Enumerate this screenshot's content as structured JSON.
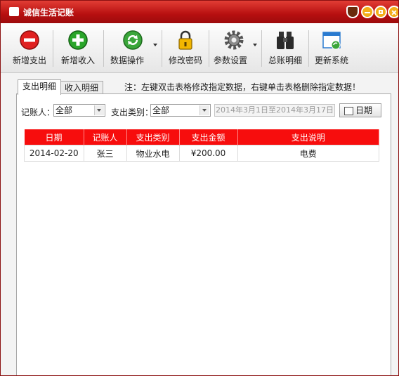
{
  "window": {
    "title": "诚信生活记账"
  },
  "toolbar": {
    "items": [
      {
        "label": "新增支出",
        "icon": "minus-circle-icon",
        "color": "#e02020"
      },
      {
        "label": "新增收入",
        "icon": "plus-circle-icon",
        "color": "#2aa52a"
      },
      {
        "label": "数据操作",
        "icon": "refresh-icon",
        "color": "#3aa63a"
      },
      {
        "label": "修改密码",
        "icon": "lock-icon",
        "color": "#f2b600"
      },
      {
        "label": "参数设置",
        "icon": "gear-icon",
        "color": "#555555"
      },
      {
        "label": "总账明细",
        "icon": "binoculars-icon",
        "color": "#333333"
      },
      {
        "label": "更新系统",
        "icon": "update-window-icon",
        "color": "#2a7bd0"
      }
    ]
  },
  "tabs": [
    {
      "label": "支出明细"
    },
    {
      "label": "收入明细"
    }
  ],
  "note": "注：左键双击表格修改指定数据，右键单击表格删除指定数据！",
  "filters": {
    "recorder_label": "记账人：",
    "recorder_value": "全部",
    "category_label": "支出类别：",
    "category_value": "全部",
    "date_range": "2014年3月1日至2014年3月17日",
    "date_button": "日期"
  },
  "table": {
    "columns": [
      "日期",
      "记账人",
      "支出类别",
      "支出金额",
      "支出说明"
    ],
    "rows": [
      [
        "2014-02-20",
        "张三",
        "物业水电",
        "¥200.00",
        "电费"
      ]
    ]
  },
  "colors": {
    "title_bar": "#c4141a",
    "header": "#f70d0d"
  }
}
